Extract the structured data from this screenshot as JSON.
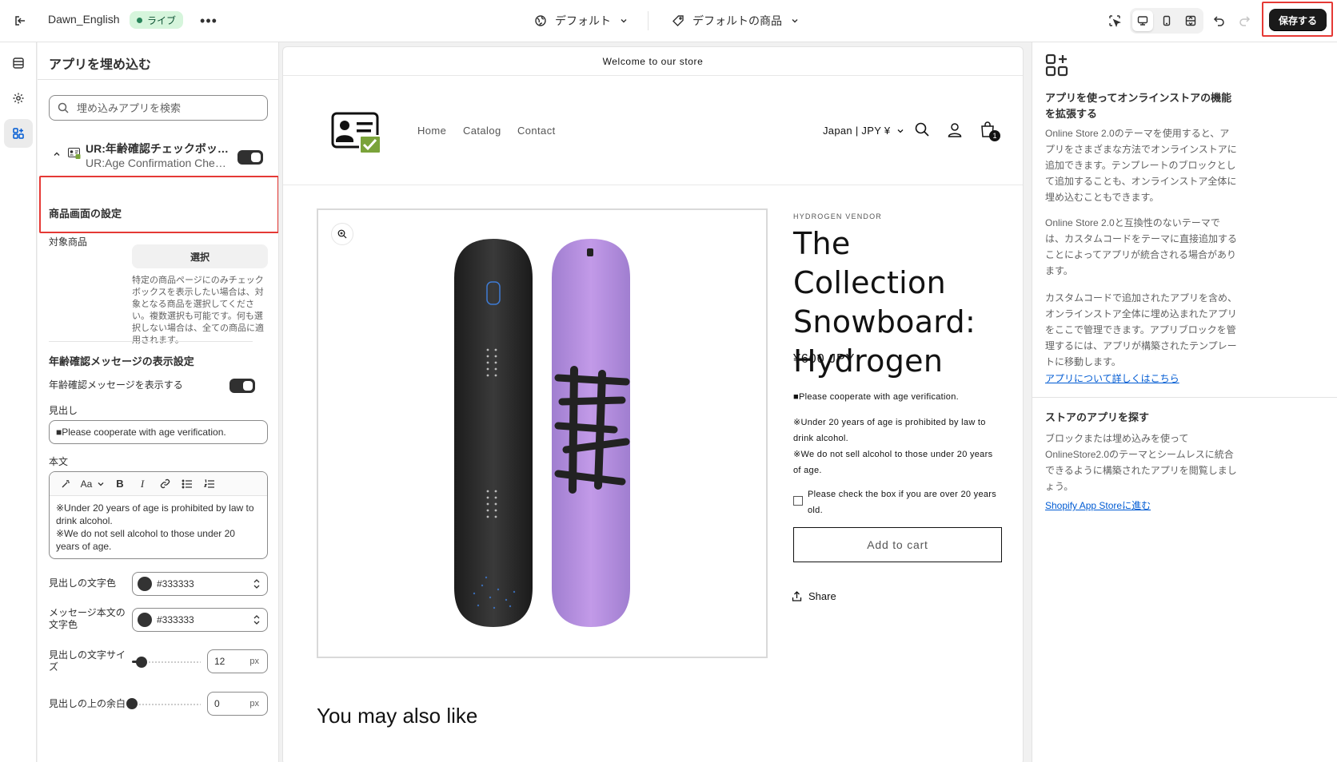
{
  "topbar": {
    "theme_name": "Dawn_English",
    "live_label": "ライブ",
    "template_select": "デフォルト",
    "product_select": "デフォルトの商品",
    "save_label": "保存する"
  },
  "panel": {
    "title": "アプリを埋め込む",
    "search_placeholder": "埋め込みアプリを検索",
    "app": {
      "name": "UR:年齢確認チェックボックス",
      "subtitle": "UR:Age Confirmation Checkbox",
      "enabled": true
    },
    "product_settings": {
      "title": "商品画面の設定",
      "target_label": "対象商品",
      "select_label": "選択",
      "help": "特定の商品ページにのみチェックボックスを表示したい場合は、対象となる商品を選択してください。複数選択も可能です。何も選択しない場合は、全ての商品に適用されます。"
    },
    "message_settings": {
      "title": "年齢確認メッセージの表示設定",
      "show_label": "年齢確認メッセージを表示する",
      "show_enabled": true,
      "heading_label": "見出し",
      "heading_value": "■Please cooperate with age verification.",
      "body_label": "本文",
      "body_value": "※Under 20 years of age is prohibited by law to drink alcohol.\n※We do not sell alcohol to those under 20 years of age.",
      "heading_color_label": "見出しの文字色",
      "heading_color": "#333333",
      "body_color_label": "メッセージ本文の文字色",
      "body_color": "#333333",
      "heading_size_label": "見出しの文字サイズ",
      "heading_size": "12",
      "heading_size_unit": "px",
      "heading_size_fraction": 0.12,
      "top_margin_label": "見出しの上の余白",
      "top_margin": "0",
      "top_margin_unit": "px",
      "top_margin_fraction": 0.0
    }
  },
  "preview": {
    "announcement": "Welcome to our store",
    "nav": [
      "Home",
      "Catalog",
      "Contact"
    ],
    "country": "Japan | JPY ¥",
    "cart_count": "1",
    "vendor": "HYDROGEN VENDOR",
    "product_title": "The Collection Snowboard: Hydrogen",
    "price": "¥600 JPY",
    "message_heading": "■Please cooperate with age verification.",
    "message_body": "※Under 20 years of age is prohibited by law to drink alcohol.\n※We do not sell alcohol to those under 20 years of age.",
    "consent_text": "Please check the box if you are over 20 years old.",
    "add_to_cart": "Add to cart",
    "share": "Share",
    "you_may": "You may also like"
  },
  "info": {
    "title": "アプリを使ってオンラインストアの機能を拡張する",
    "p1": "Online Store 2.0のテーマを使用すると、アプリをさまざまな方法でオンラインストアに追加できます。テンプレートのブロックとして追加することも、オンラインストア全体に埋め込むこともできます。",
    "p2": "Online Store 2.0と互換性のないテーマでは、カスタムコードをテーマに直接追加することによってアプリが統合される場合があります。",
    "p3": "カスタムコードで追加されたアプリを含め、オンラインストア全体に埋め込まれたアプリをここで管理できます。アプリブロックを管理するには、アプリが構築されたテンプレートに移動します。",
    "link1": "アプリについて詳しくはこちら",
    "find_title": "ストアのアプリを探す",
    "find_text": "ブロックまたは埋め込みを使ってOnlineStore2.0のテーマとシームレスに統合できるように構築されたアプリを閲覧しましょう。",
    "link2": "Shopify App Storeに進む"
  },
  "colors": {
    "accent_highlight": "#e53935",
    "save_bg": "#1a1a1a",
    "link": "#005bd3",
    "live_badge_bg": "#d6f5dc",
    "board_purple": "#b58ee0"
  }
}
